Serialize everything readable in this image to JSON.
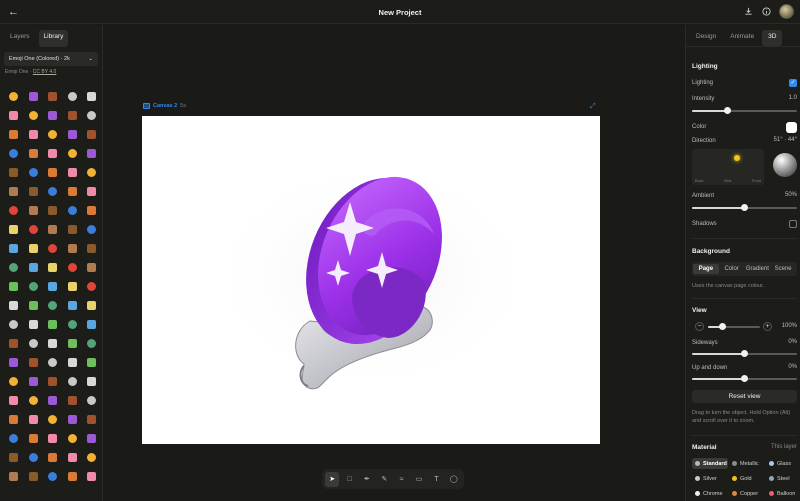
{
  "header": {
    "title": "New Project"
  },
  "left_panel": {
    "tabs": [
      {
        "label": "Layers",
        "active": false
      },
      {
        "label": "Library",
        "active": true
      }
    ],
    "dropdown_value": "Emoji One (Colored) · 2k",
    "attribution": {
      "prefix": "Emoji One · ",
      "license": "CC BY 4.0"
    }
  },
  "canvas": {
    "name": "Canvas 2",
    "duration": "5s"
  },
  "right_panel": {
    "tabs": [
      {
        "label": "Design",
        "active": false
      },
      {
        "label": "Animate",
        "active": false
      },
      {
        "label": "3D",
        "active": true
      }
    ],
    "lighting": {
      "heading": "Lighting",
      "toggle_label": "Lighting",
      "enabled": true,
      "intensity_label": "Intensity",
      "intensity_value": "1.0",
      "intensity_fraction": 0.34,
      "color_label": "Color",
      "color": "#ffffff",
      "direction_label": "Direction",
      "direction_value": "51° · 44°",
      "pad_labels": [
        "Back",
        "Side",
        "Front"
      ],
      "ambient_label": "Ambient",
      "ambient_value": "50%",
      "ambient_fraction": 0.5,
      "shadows_label": "Shadows",
      "shadows_enabled": false
    },
    "background": {
      "heading": "Background",
      "options": [
        {
          "label": "Page",
          "active": true
        },
        {
          "label": "Color",
          "active": false
        },
        {
          "label": "Gradient",
          "active": false
        },
        {
          "label": "Scene",
          "active": false
        }
      ],
      "note": "Uses the canvas page colour."
    },
    "view": {
      "heading": "View",
      "zoom_value": "100%",
      "zoom_fraction": 0.28,
      "sideways_label": "Sideways",
      "sideways_value": "0%",
      "sideways_fraction": 0.5,
      "updown_label": "Up and down",
      "updown_value": "0%",
      "updown_fraction": 0.5,
      "reset_label": "Reset view",
      "note": "Drag to turn the object. Hold Option (Alt) and scroll over it to zoom."
    },
    "material": {
      "heading": "Material",
      "scope": "This layer",
      "options": [
        {
          "label": "Standard",
          "active": true,
          "color": "#b9b9b9"
        },
        {
          "label": "Metallic",
          "active": false,
          "color": "#8c8c8c"
        },
        {
          "label": "Glass",
          "active": false,
          "color": "#a9c9f0"
        },
        {
          "label": "Silver",
          "active": false,
          "color": "#c8c8c8"
        },
        {
          "label": "Gold",
          "active": false,
          "color": "#f0c419"
        },
        {
          "label": "Steel",
          "active": false,
          "color": "#9aa3ad"
        },
        {
          "label": "Chrome",
          "active": false,
          "color": "#eeeeee"
        },
        {
          "label": "Copper",
          "active": false,
          "color": "#d98a3d"
        },
        {
          "label": "Balloon",
          "active": false,
          "color": "#f05a78"
        }
      ]
    }
  },
  "toolbar": {
    "tools": [
      {
        "icon": "pointer-icon",
        "active": true
      },
      {
        "icon": "frame-icon",
        "active": false
      },
      {
        "icon": "pen-icon",
        "active": false
      },
      {
        "icon": "pencil-icon",
        "active": false
      },
      {
        "icon": "brush-icon",
        "active": false
      },
      {
        "icon": "eraser-icon",
        "active": false
      },
      {
        "icon": "text-icon",
        "active": false
      },
      {
        "icon": "shape-icon",
        "active": false
      }
    ]
  },
  "colors": {
    "accent": "#2e8bf0",
    "panel": "#1c1c19",
    "workspace": "#1a1a17",
    "orb_purple": "#9b30e8"
  }
}
